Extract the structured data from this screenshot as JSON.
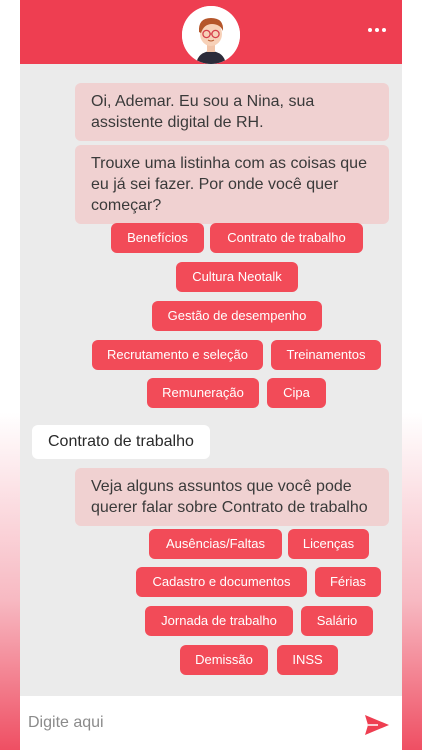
{
  "header": {
    "avatar_icon": "assistant-avatar",
    "menu_icon": "more-horizontal-icon",
    "accent_color": "#ee3e51"
  },
  "messages": {
    "greeting": "Oi, Ademar. Eu sou a Nina, sua assistente digital de RH.",
    "intro": "Trouxe uma listinha com as coisas que eu já sei fazer. Por onde você quer começar?",
    "user_reply": "Contrato de trabalho",
    "followup": "Veja alguns assuntos que você pode querer falar sobre Contrato de trabalho"
  },
  "topics": [
    "Benefícios",
    "Contrato de trabalho",
    "Cultura Neotalk",
    "Gestão de desempenho",
    "Recrutamento e seleção",
    "Treinamentos",
    "Remuneração",
    "Cipa"
  ],
  "subtopics": [
    "Ausências/Faltas",
    "Licenças",
    "Cadastro e documentos",
    "Férias",
    "Jornada de trabalho",
    "Salário",
    "Demissão",
    "INSS"
  ],
  "input": {
    "placeholder": "Digite aqui",
    "send_icon": "send-icon"
  }
}
